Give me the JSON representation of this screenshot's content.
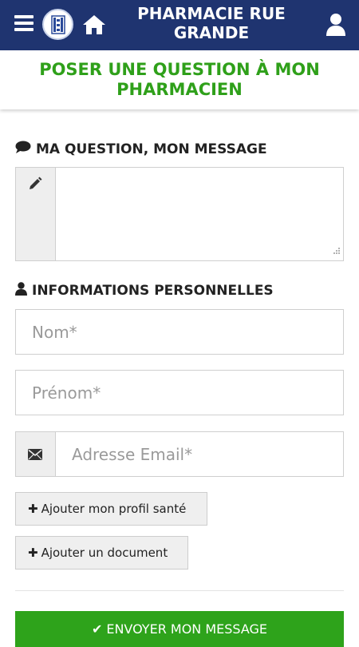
{
  "header": {
    "title": "PHARMACIE RUE GRANDE",
    "menu_icon": "hamburger-menu-icon",
    "home_icon": "home-icon",
    "user_icon": "user-icon",
    "background_color": "#1f3470"
  },
  "subheader": {
    "heading": "POSER UNE QUESTION À MON PHARMACIEN",
    "color": "#2fa01a"
  },
  "message_section": {
    "title": "MA QUESTION, MON MESSAGE",
    "icon": "comment-icon",
    "textarea_icon": "pencil-icon",
    "value": ""
  },
  "personal_section": {
    "title": "INFORMATIONS PERSONNELLES",
    "icon": "user-icon",
    "last_name_placeholder": "Nom*",
    "first_name_placeholder": "Prénom*",
    "email_placeholder": "Adresse Email*",
    "email_icon": "envelope-icon"
  },
  "buttons": {
    "add_health_profile": "Ajouter mon profil santé",
    "add_document": "Ajouter un document",
    "submit": "ENVOYER MON MESSAGE",
    "submit_color": "#2ea31b"
  }
}
